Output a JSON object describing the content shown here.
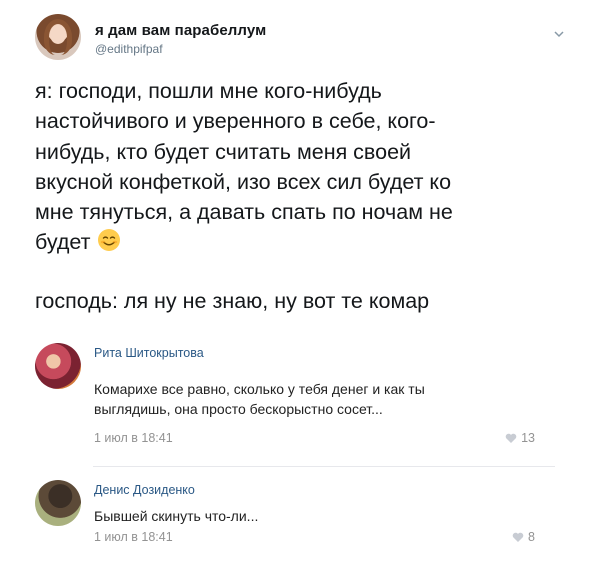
{
  "tweet": {
    "author_name": "я дам вам парабеллум",
    "author_handle": "@edithpifpaf",
    "lines": [
      "я: господи, пошли мне кого-нибудь",
      "настойчивого и уверенного в себе, кого-",
      "нибудь, кто будет считать меня своей",
      "вкусной конфеткой, изо всех сил будет ко",
      "мне тянуться, а давать спать по ночам не",
      "будет"
    ],
    "second_paragraph": "господь: ля ну не знаю, ну вот те комар",
    "emoji": "smiling-face-icon",
    "menu_icon": "chevron-down-icon"
  },
  "comments": [
    {
      "name": "Рита Шитокрытова",
      "text_lines": [
        "Комарихе все равно, сколько у тебя денег и как ты",
        "выглядишь, она просто бескорыстно сосет..."
      ],
      "date": "1 июл в 18:41",
      "likes": "13"
    },
    {
      "name": "Денис Дозиденко",
      "text_lines": [
        "Бывшей скинуть что-ли..."
      ],
      "date": "1 июл в 18:41",
      "likes": "8"
    }
  ],
  "colors": {
    "text": "#14171a",
    "handle": "#657786",
    "comment_name": "#2a5885",
    "meta": "#939393"
  }
}
